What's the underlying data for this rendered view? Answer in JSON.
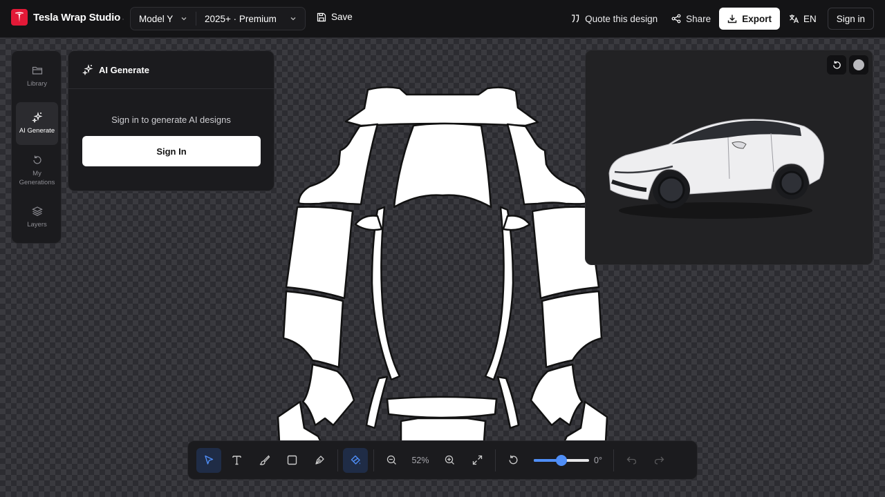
{
  "app": {
    "name": "Tesla Wrap Studio"
  },
  "header": {
    "model": "Model Y",
    "variant": "2025+ · Premium",
    "save_label": "Save",
    "quote_label": "Quote this design",
    "share_label": "Share",
    "export_label": "Export",
    "language": "EN",
    "signin_label": "Sign in"
  },
  "sidebar": {
    "items": [
      {
        "label": "Library",
        "icon": "folder-icon",
        "active": false
      },
      {
        "label": "AI Generate",
        "icon": "sparkles-icon",
        "active": true
      },
      {
        "label": "My Generations",
        "icon": "history-icon",
        "active": false
      },
      {
        "label": "Layers",
        "icon": "layers-icon",
        "active": false
      }
    ]
  },
  "ai_panel": {
    "title": "AI Generate",
    "message": "Sign in to generate AI designs",
    "button_label": "Sign In"
  },
  "preview": {
    "paint_color": "#b9b9bd",
    "car_color": "#eeeef0"
  },
  "toolbar": {
    "tools": [
      "select-tool",
      "text-tool",
      "brush-tool",
      "rectangle-tool",
      "pen-tool",
      "fill-tool"
    ],
    "active_tool": "select-tool",
    "zoom": "52%",
    "rotation": "0°",
    "rotation_slider_fraction": 0.5
  },
  "colors": {
    "accent": "#4f8ef7",
    "brand": "#e31937",
    "background": "#141416"
  }
}
